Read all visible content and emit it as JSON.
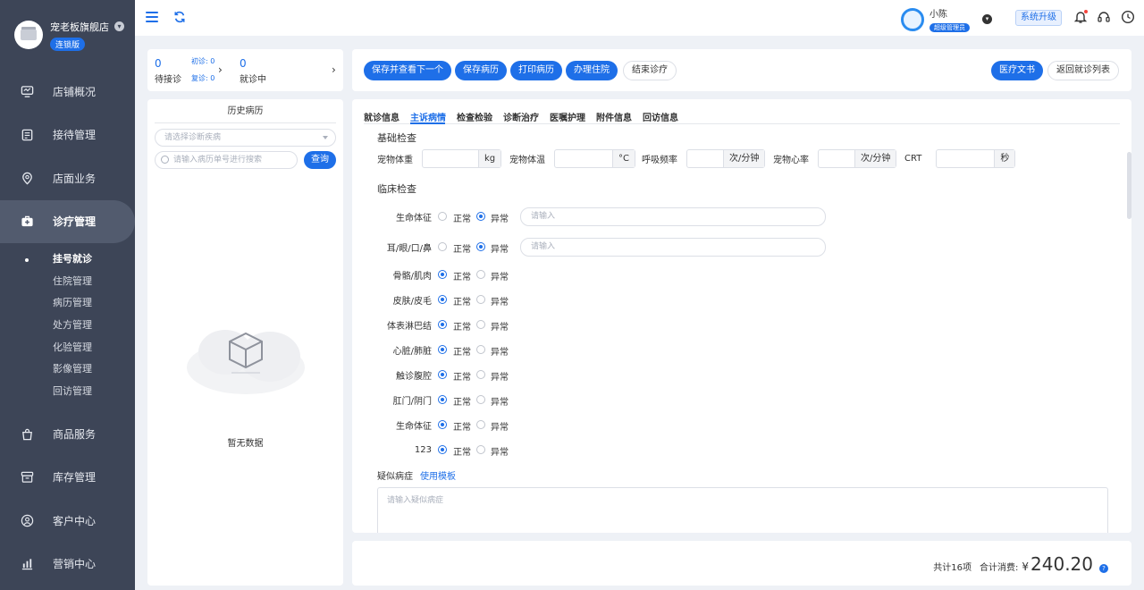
{
  "store": {
    "name": "宠老板旗舰店",
    "badge": "连锁版"
  },
  "nav": {
    "items": [
      {
        "label": "店铺概况"
      },
      {
        "label": "接待管理"
      },
      {
        "label": "店面业务"
      },
      {
        "label": "诊疗管理"
      },
      {
        "label": "商品服务"
      },
      {
        "label": "库存管理"
      },
      {
        "label": "客户中心"
      },
      {
        "label": "营销中心"
      }
    ],
    "sub": [
      "挂号就诊",
      "住院管理",
      "病历管理",
      "处方管理",
      "化验管理",
      "影像管理",
      "回访管理"
    ]
  },
  "topbar": {
    "user_name": "小陈",
    "user_role": "超级管理员",
    "upgrade": "系统升级"
  },
  "status": {
    "waiting_count": "0",
    "waiting_label": "待接诊",
    "first_label": "初诊:",
    "first_count": "0",
    "repeat_label": "复诊:",
    "repeat_count": "0",
    "inprogress_count": "0",
    "inprogress_label": "就诊中"
  },
  "history": {
    "title": "历史病历",
    "select_placeholder": "请选择诊断疾病",
    "search_placeholder": "请输入病历单号进行搜索",
    "search_btn": "查询",
    "empty": "暂无数据"
  },
  "actions": {
    "save_next": "保存并查看下一个",
    "save": "保存病历",
    "print": "打印病历",
    "hospitalize": "办理住院",
    "end": "结束诊疗",
    "doc": "医疗文书",
    "back": "返回就诊列表"
  },
  "tabs": [
    "就诊信息",
    "主诉病情",
    "检查检验",
    "诊断治疗",
    "医嘱护理",
    "附件信息",
    "回访信息"
  ],
  "basic": {
    "title": "基础检查",
    "fields": [
      {
        "label": "宠物体重",
        "unit": "kg"
      },
      {
        "label": "宠物体温",
        "unit": "°C"
      },
      {
        "label": "呼吸频率",
        "unit": "次/分钟"
      },
      {
        "label": "宠物心率",
        "unit": "次/分钟"
      },
      {
        "label": "CRT",
        "unit": "秒"
      }
    ]
  },
  "clinical": {
    "title": "临床检查",
    "normal": "正常",
    "abnormal": "异常",
    "input_placeholder": "请输入",
    "rows": [
      {
        "label": "生命体征",
        "state": "abnormal"
      },
      {
        "label": "耳/眼/口/鼻",
        "state": "abnormal"
      },
      {
        "label": "骨骼/肌肉",
        "state": "normal"
      },
      {
        "label": "皮肤/皮毛",
        "state": "normal"
      },
      {
        "label": "体表淋巴结",
        "state": "normal"
      },
      {
        "label": "心脏/肺脏",
        "state": "normal"
      },
      {
        "label": "触诊腹腔",
        "state": "normal"
      },
      {
        "label": "肛门/阴门",
        "state": "normal"
      },
      {
        "label": "生命体征",
        "state": "normal"
      },
      {
        "label": "123",
        "state": "normal"
      }
    ]
  },
  "suspect": {
    "label": "疑似病症",
    "link": "使用模板",
    "placeholder": "请输入疑似病症"
  },
  "total": {
    "count_text": "共计16项",
    "label": "合计消费:",
    "currency": "¥",
    "amount": "240.20"
  },
  "colors": {
    "primary": "#1e6fe8",
    "sidebar": "#3d4557"
  }
}
